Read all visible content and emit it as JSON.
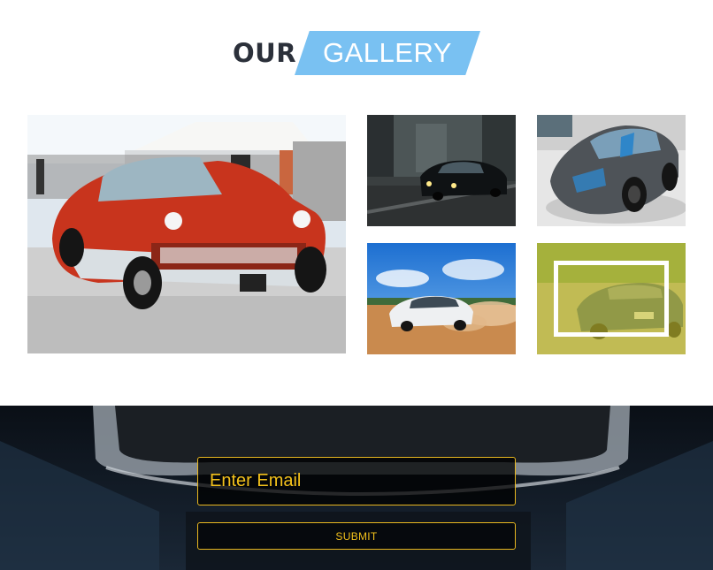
{
  "gallery": {
    "heading": {
      "prefix": "OUR",
      "highlight": "GALLERY",
      "highlight_color": "#79c1f2"
    },
    "hover_overlay_color": "#d6cd28"
  },
  "subscribe": {
    "email_placeholder": "Enter Email",
    "submit_label": "SUBMIT",
    "accent_color": "#f3c11b"
  }
}
